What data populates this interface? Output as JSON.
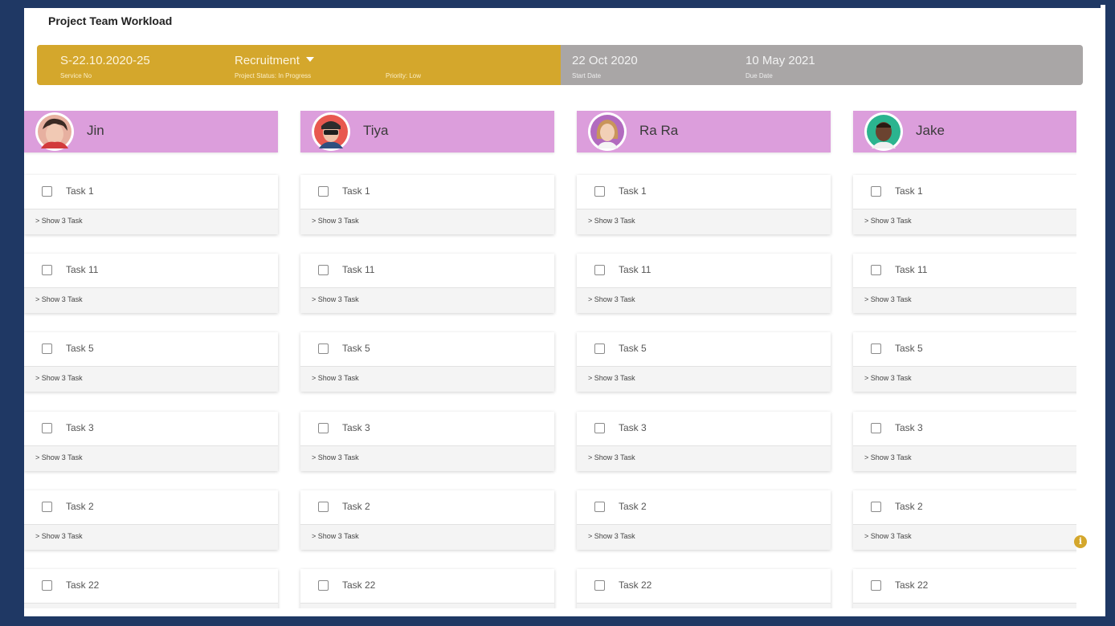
{
  "page": {
    "title": "Project Team Workload"
  },
  "project": {
    "service_no_value": "S-22.10.2020-25",
    "service_no_label": "Service No",
    "category_value": "Recruitment",
    "status_label": "Project Status: In Progress",
    "priority_label": "Priority: Low",
    "start_date_value": "22 Oct 2020",
    "start_date_label": "Start Date",
    "due_date_value": "10 May 2021",
    "due_date_label": "Due Date"
  },
  "colors": {
    "info_left": "#d4a72c",
    "info_right": "#a9a6a6",
    "member_header": "#dc9edc",
    "frame": "#1f3864"
  },
  "members": [
    {
      "name": "Jin",
      "avatar_icon": "avatar-jin",
      "tasks": [
        {
          "label": "Task 1",
          "show": "> Show 3 Task"
        },
        {
          "label": "Task 11",
          "show": "> Show 3 Task"
        },
        {
          "label": "Task 5",
          "show": "> Show 3 Task"
        },
        {
          "label": "Task 3",
          "show": "> Show 3 Task"
        },
        {
          "label": "Task 2",
          "show": "> Show 3 Task"
        },
        {
          "label": "Task 22",
          "show": ""
        }
      ]
    },
    {
      "name": "Tiya",
      "avatar_icon": "avatar-tiya",
      "tasks": [
        {
          "label": "Task 1",
          "show": "> Show 3 Task"
        },
        {
          "label": "Task 11",
          "show": "> Show 3 Task"
        },
        {
          "label": "Task 5",
          "show": "> Show 3 Task"
        },
        {
          "label": "Task 3",
          "show": "> Show 3 Task"
        },
        {
          "label": "Task 2",
          "show": "> Show 3 Task"
        },
        {
          "label": "Task 22",
          "show": ""
        }
      ]
    },
    {
      "name": "Ra Ra",
      "avatar_icon": "avatar-rara",
      "tasks": [
        {
          "label": "Task 1",
          "show": "> Show 3 Task"
        },
        {
          "label": "Task 11",
          "show": "> Show 3 Task"
        },
        {
          "label": "Task 5",
          "show": "> Show 3 Task"
        },
        {
          "label": "Task 3",
          "show": "> Show 3 Task"
        },
        {
          "label": "Task 2",
          "show": "> Show 3 Task"
        },
        {
          "label": "Task 22",
          "show": ""
        }
      ]
    },
    {
      "name": "Jake",
      "avatar_icon": "avatar-jake",
      "tasks": [
        {
          "label": "Task 1",
          "show": "> Show 3 Task"
        },
        {
          "label": "Task 11",
          "show": "> Show 3 Task"
        },
        {
          "label": "Task 5",
          "show": "> Show 3 Task"
        },
        {
          "label": "Task 3",
          "show": "> Show 3 Task"
        },
        {
          "label": "Task 2",
          "show": "> Show 3 Task"
        },
        {
          "label": "Task 22",
          "show": ""
        }
      ]
    }
  ],
  "info_icon": "info-icon"
}
